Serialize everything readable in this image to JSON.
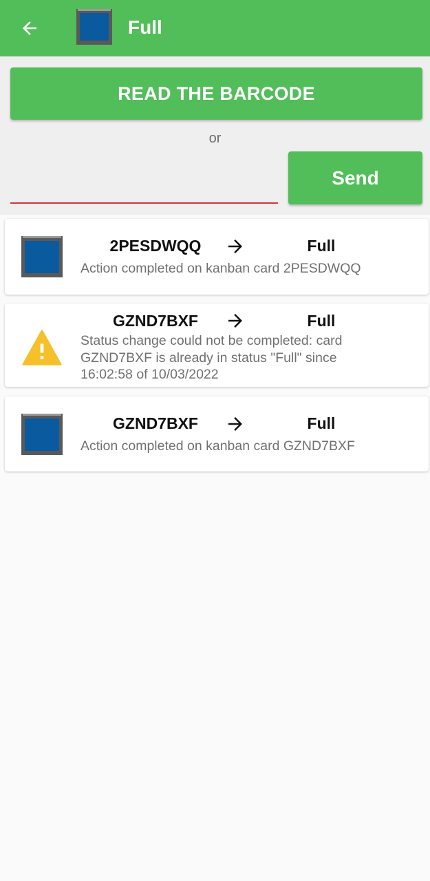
{
  "appbar": {
    "title": "Full",
    "back_icon": "arrow-back-icon",
    "status_icon": "full-bin-icon",
    "color": "#52be5a"
  },
  "scan": {
    "read_button_label": "READ THE BARCODE",
    "or_label": "or",
    "input_value": "",
    "send_label": "Send"
  },
  "results": [
    {
      "icon": "full-bin-icon",
      "code": "2PESDWQQ",
      "status": "Full",
      "message": "Action completed on kanban card 2PESDWQQ"
    },
    {
      "icon": "warning-icon",
      "code": "GZND7BXF",
      "status": "Full",
      "message": "Status change could not be completed: card GZND7BXF is already in status \"Full\" since 16:02:58 of 10/03/2022"
    },
    {
      "icon": "full-bin-icon",
      "code": "GZND7BXF",
      "status": "Full",
      "message": "Action completed on kanban card GZND7BXF"
    }
  ],
  "colors": {
    "accent": "#52be5a",
    "bin_fill": "#0a5aa0",
    "bin_frame": "#555555",
    "warning": "#f6c02b",
    "input_underline": "#d0353c"
  }
}
